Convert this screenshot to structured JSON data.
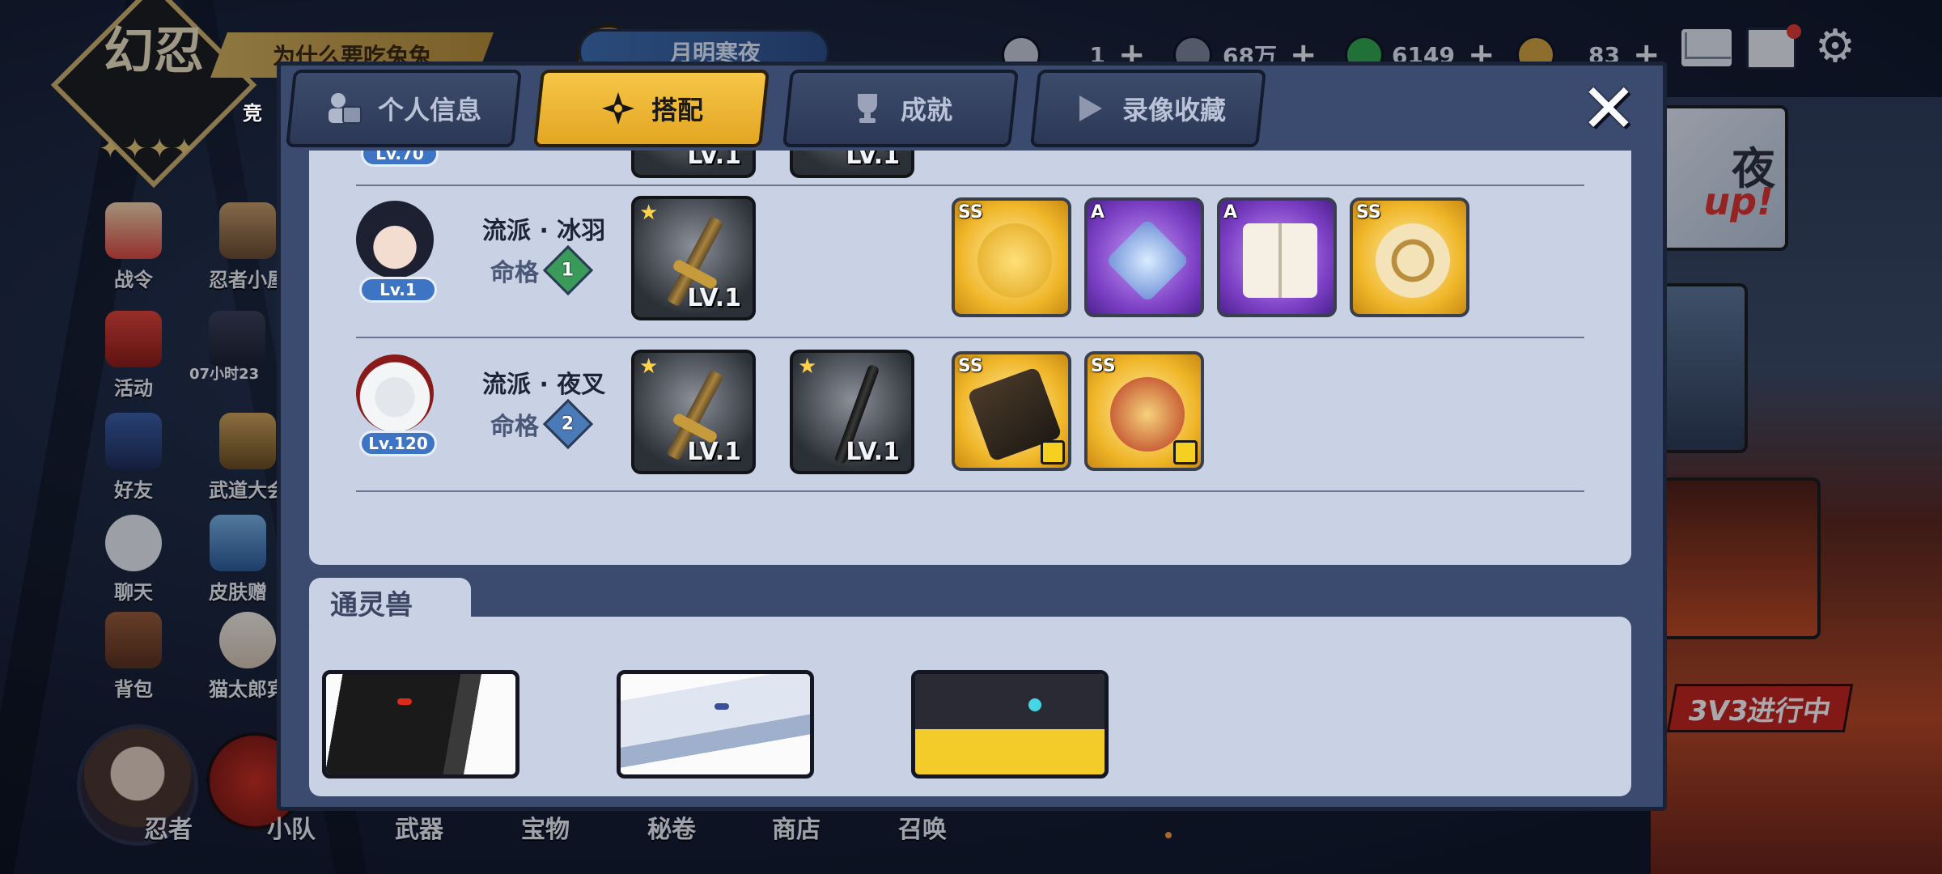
{
  "top_bar": {
    "logo_text": "幻忍",
    "logo_stars": "✦✦✦✦",
    "notice": "为什么要吃兔兔",
    "event_name": "月明寒夜",
    "resources": [
      {
        "icon": "silver-coin-icon",
        "value": "1",
        "color": "#c7ccd6"
      },
      {
        "icon": "gray-gem-icon",
        "value": "68万",
        "color": "#7c8596"
      },
      {
        "icon": "green-gem-icon",
        "value": "6149",
        "color": "#2fa84c"
      },
      {
        "icon": "gold-coin-icon",
        "value": "83",
        "color": "#d6a53a"
      }
    ],
    "plus": "+"
  },
  "sidebar": {
    "col1": [
      "战令",
      "活动",
      "好友",
      "聊天",
      "背包"
    ],
    "col2": [
      "忍者小屋",
      "武道大会",
      "皮肤赠送",
      "猫太郎宾"
    ],
    "col2_visible": [
      "忍者小屋",
      "",
      "武道大会",
      "皮肤赠",
      "猫太郎宾"
    ],
    "timer": "07小时23",
    "side_label_partial": "竞"
  },
  "bottom_nav": [
    "忍者",
    "小队",
    "武器",
    "宝物",
    "秘卷",
    "商店",
    "召唤"
  ],
  "right_panel": {
    "card_text": "夜",
    "card_up": "up!",
    "banner_3v3": "3V3进行中"
  },
  "modal": {
    "tabs": [
      {
        "label": "个人信息",
        "icon": "profile-card-icon",
        "active": false
      },
      {
        "label": "搭配",
        "icon": "shuriken-icon",
        "active": true
      },
      {
        "label": "成就",
        "icon": "trophy-icon",
        "active": false
      },
      {
        "label": "录像收藏",
        "icon": "play-icon",
        "active": false
      }
    ],
    "close_symbol": "✕",
    "partial_row": {
      "lv": "Lv.70",
      "weapon_lv_1": "LV.1",
      "weapon_lv_2": "LV.1"
    },
    "heroes": [
      {
        "level": "Lv.1",
        "school": "流派 · 冰羽",
        "fate_label": "命格",
        "fate_value": "1",
        "fate_color": "#3a9a5a",
        "weapons": [
          {
            "lv": "LV.1",
            "kind": "sword"
          }
        ],
        "scrolls": [
          {
            "grade": "SS",
            "tier": "ss",
            "art": "golden-doll-icon"
          },
          {
            "grade": "A",
            "tier": "a",
            "art": "ice-crystal-icon"
          },
          {
            "grade": "A",
            "tier": "a",
            "art": "red-rune-book-icon"
          },
          {
            "grade": "SS",
            "tier": "ss",
            "art": "golden-sigil-icon"
          }
        ]
      },
      {
        "level": "Lv.120",
        "school": "流派 · 夜叉",
        "fate_label": "命格",
        "fate_value": "2",
        "fate_color": "#4a7ab8",
        "weapons": [
          {
            "lv": "LV.1",
            "kind": "sword"
          },
          {
            "lv": "LV.1",
            "kind": "katana"
          }
        ],
        "scrolls": [
          {
            "grade": "SS",
            "tier": "ss",
            "art": "gauntlet-icon"
          },
          {
            "grade": "SS",
            "tier": "ss",
            "art": "red-scroll-icon"
          }
        ]
      }
    ],
    "beasts_title": "通灵兽",
    "beasts": [
      {
        "art": "black-dragon-icon"
      },
      {
        "art": "white-eagle-icon"
      },
      {
        "art": "crow-beast-icon"
      }
    ]
  }
}
